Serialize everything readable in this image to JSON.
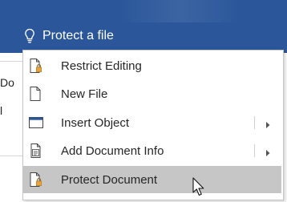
{
  "search": {
    "text": "Protect a file",
    "icon": "lightbulb-icon"
  },
  "background_doc": {
    "fragments": [
      "Do",
      "l"
    ]
  },
  "menu": {
    "items": [
      {
        "label": "Restrict Editing",
        "icon": "restrict-editing-icon",
        "submenu": false,
        "highlighted": false
      },
      {
        "label": "New File",
        "icon": "new-file-icon",
        "submenu": false,
        "highlighted": false
      },
      {
        "label": "Insert Object",
        "icon": "insert-object-icon",
        "submenu": true,
        "highlighted": false
      },
      {
        "label": "Add Document Info",
        "icon": "document-info-icon",
        "submenu": true,
        "highlighted": false
      },
      {
        "label": "Protect Document",
        "icon": "protect-document-icon",
        "submenu": false,
        "highlighted": true
      }
    ]
  },
  "colors": {
    "ribbon": "#2b579a",
    "highlight": "#c6c6c6",
    "lock_accent": "#e8a33d"
  }
}
